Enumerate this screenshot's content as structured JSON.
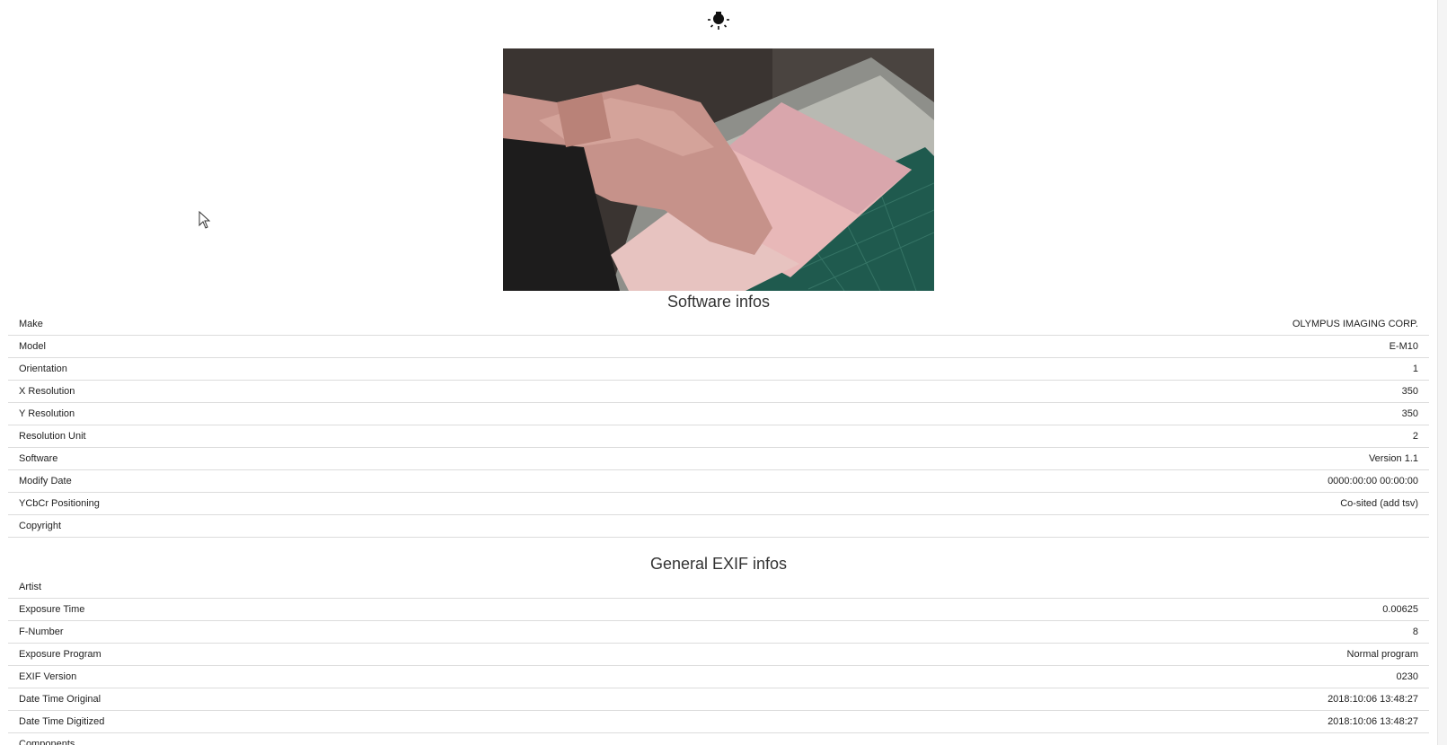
{
  "theme_toggle": {
    "icon": "lightbulb-icon"
  },
  "photo": {
    "icon": "passport-scanner-photo"
  },
  "software_section": {
    "title": "Software infos",
    "rows": [
      {
        "label": "Make",
        "value": "OLYMPUS IMAGING CORP."
      },
      {
        "label": "Model",
        "value": "E-M10"
      },
      {
        "label": "Orientation",
        "value": "1"
      },
      {
        "label": "X Resolution",
        "value": "350"
      },
      {
        "label": "Y Resolution",
        "value": "350"
      },
      {
        "label": "Resolution Unit",
        "value": "2"
      },
      {
        "label": "Software",
        "value": "Version 1.1"
      },
      {
        "label": "Modify Date",
        "value": "0000:00:00 00:00:00"
      },
      {
        "label": "YCbCr Positioning",
        "value": "Co-sited (add tsv)"
      },
      {
        "label": "Copyright",
        "value": ""
      }
    ]
  },
  "exif_section": {
    "title": "General EXIF infos",
    "rows": [
      {
        "label": "Artist",
        "value": ""
      },
      {
        "label": "Exposure Time",
        "value": "0.00625"
      },
      {
        "label": "F-Number",
        "value": "8"
      },
      {
        "label": "Exposure Program",
        "value": "Normal program"
      },
      {
        "label": "EXIF Version",
        "value": "0230"
      },
      {
        "label": "Date Time Original",
        "value": "2018:10:06 13:48:27"
      },
      {
        "label": "Date Time Digitized",
        "value": "2018:10:06 13:48:27"
      },
      {
        "label": "Components",
        "value": ""
      }
    ]
  }
}
